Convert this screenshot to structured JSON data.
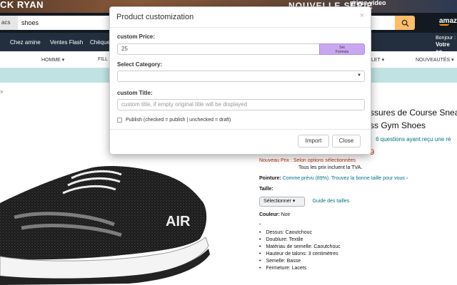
{
  "banner": {
    "left_text": "CK RYAN",
    "mid_text": "NOUVELLE SÉRIE",
    "right_text": "prime video"
  },
  "search": {
    "dept": "acs",
    "query": "shoes"
  },
  "header": {
    "logo": "amazon",
    "account_line1": "Bonjour :",
    "account_line2": "Votre co"
  },
  "subnav": {
    "items": [
      "Chez amine",
      "Ventes Flash",
      "Chèque"
    ]
  },
  "categories": [
    "HOMME ▾",
    "FILL",
    "LET ▾",
    "NOUVEAUTÉS ▾"
  ],
  "breadcrumb_arrow": "»",
  "product": {
    "title_line1": "ssures de Course Sneak",
    "title_line2": "ss Gym Shoes",
    "questions_link": "6 questions ayant reçu une ré",
    "price_fragment": "9",
    "new_price_label": "Nouveau Prix :",
    "new_price_value": "Selon options sélectionnées",
    "tva": "Tous les prix incluent la TVA.",
    "fit_label": "Pointure:",
    "fit_value": "Comme prévu (89%). Trouvez la bonne taille pour vous ›",
    "size_label": "Taille:",
    "size_select": "Sélectionner",
    "size_guide": "Guide des tailles",
    "color_label": "Couleur:",
    "color_value": "Noir",
    "bullets": [
      "Dessus: Caoutchouc",
      "Doublure: Textile",
      "Matériau de semelle: Caoutchouc",
      "Hauteur de talons: 3 centimètres",
      "Semelle: Basse",
      "Fermeture: Lacets"
    ],
    "shoe_print": "AIR"
  },
  "modal": {
    "title": "Product customization",
    "close_glyph": "×",
    "price_label": "custom Price:",
    "price_value": "25",
    "set_formula_line1": "Set",
    "set_formula_line2": "Formula",
    "category_label": "Select Category:",
    "category_value": "",
    "title_label": "custom Title:",
    "title_placeholder": "custom title, if empty original title will be displayed",
    "publish_label": "Publish (checked = publish | unchecked = draft)",
    "publish_checked": false,
    "import_label": "Import",
    "close_label": "Close"
  },
  "colors": {
    "nav_dark": "#131921",
    "nav_mid": "#232f3e",
    "search_btn": "#febd69",
    "accent_purple": "#c9a7f0",
    "price_red": "#b12704",
    "link": "#007185"
  }
}
